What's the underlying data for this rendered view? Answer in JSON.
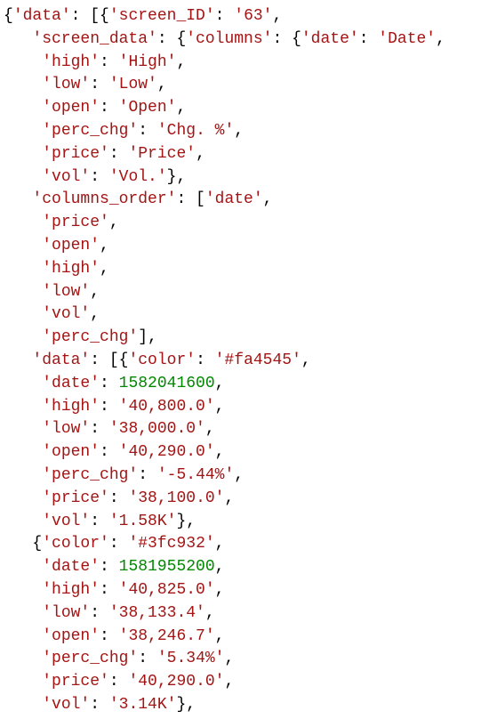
{
  "code_lines": [
    [
      [
        "punct",
        "{"
      ],
      [
        "key",
        "'data'"
      ],
      [
        "punct",
        ": [{"
      ],
      [
        "key",
        "'screen_ID'"
      ],
      [
        "punct",
        ": "
      ],
      [
        "str",
        "'63'"
      ],
      [
        "punct",
        ","
      ]
    ],
    [
      [
        "punct",
        "   "
      ],
      [
        "key",
        "'screen_data'"
      ],
      [
        "punct",
        ": {"
      ],
      [
        "key",
        "'columns'"
      ],
      [
        "punct",
        ": {"
      ],
      [
        "key",
        "'date'"
      ],
      [
        "punct",
        ": "
      ],
      [
        "str",
        "'Date'"
      ],
      [
        "punct",
        ","
      ]
    ],
    [
      [
        "punct",
        "    "
      ],
      [
        "key",
        "'high'"
      ],
      [
        "punct",
        ": "
      ],
      [
        "str",
        "'High'"
      ],
      [
        "punct",
        ","
      ]
    ],
    [
      [
        "punct",
        "    "
      ],
      [
        "key",
        "'low'"
      ],
      [
        "punct",
        ": "
      ],
      [
        "str",
        "'Low'"
      ],
      [
        "punct",
        ","
      ]
    ],
    [
      [
        "punct",
        "    "
      ],
      [
        "key",
        "'open'"
      ],
      [
        "punct",
        ": "
      ],
      [
        "str",
        "'Open'"
      ],
      [
        "punct",
        ","
      ]
    ],
    [
      [
        "punct",
        "    "
      ],
      [
        "key",
        "'perc_chg'"
      ],
      [
        "punct",
        ": "
      ],
      [
        "str",
        "'Chg. %'"
      ],
      [
        "punct",
        ","
      ]
    ],
    [
      [
        "punct",
        "    "
      ],
      [
        "key",
        "'price'"
      ],
      [
        "punct",
        ": "
      ],
      [
        "str",
        "'Price'"
      ],
      [
        "punct",
        ","
      ]
    ],
    [
      [
        "punct",
        "    "
      ],
      [
        "key",
        "'vol'"
      ],
      [
        "punct",
        ": "
      ],
      [
        "str",
        "'Vol.'"
      ],
      [
        "punct",
        "},"
      ]
    ],
    [
      [
        "punct",
        "   "
      ],
      [
        "key",
        "'columns_order'"
      ],
      [
        "punct",
        ": ["
      ],
      [
        "str",
        "'date'"
      ],
      [
        "punct",
        ","
      ]
    ],
    [
      [
        "punct",
        "    "
      ],
      [
        "str",
        "'price'"
      ],
      [
        "punct",
        ","
      ]
    ],
    [
      [
        "punct",
        "    "
      ],
      [
        "str",
        "'open'"
      ],
      [
        "punct",
        ","
      ]
    ],
    [
      [
        "punct",
        "    "
      ],
      [
        "str",
        "'high'"
      ],
      [
        "punct",
        ","
      ]
    ],
    [
      [
        "punct",
        "    "
      ],
      [
        "str",
        "'low'"
      ],
      [
        "punct",
        ","
      ]
    ],
    [
      [
        "punct",
        "    "
      ],
      [
        "str",
        "'vol'"
      ],
      [
        "punct",
        ","
      ]
    ],
    [
      [
        "punct",
        "    "
      ],
      [
        "str",
        "'perc_chg'"
      ],
      [
        "punct",
        "],"
      ]
    ],
    [
      [
        "punct",
        "   "
      ],
      [
        "key",
        "'data'"
      ],
      [
        "punct",
        ": [{"
      ],
      [
        "key",
        "'color'"
      ],
      [
        "punct",
        ": "
      ],
      [
        "str",
        "'#fa4545'"
      ],
      [
        "punct",
        ","
      ]
    ],
    [
      [
        "punct",
        "    "
      ],
      [
        "key",
        "'date'"
      ],
      [
        "punct",
        ": "
      ],
      [
        "num",
        "1582041600"
      ],
      [
        "punct",
        ","
      ]
    ],
    [
      [
        "punct",
        "    "
      ],
      [
        "key",
        "'high'"
      ],
      [
        "punct",
        ": "
      ],
      [
        "str",
        "'40,800.0'"
      ],
      [
        "punct",
        ","
      ]
    ],
    [
      [
        "punct",
        "    "
      ],
      [
        "key",
        "'low'"
      ],
      [
        "punct",
        ": "
      ],
      [
        "str",
        "'38,000.0'"
      ],
      [
        "punct",
        ","
      ]
    ],
    [
      [
        "punct",
        "    "
      ],
      [
        "key",
        "'open'"
      ],
      [
        "punct",
        ": "
      ],
      [
        "str",
        "'40,290.0'"
      ],
      [
        "punct",
        ","
      ]
    ],
    [
      [
        "punct",
        "    "
      ],
      [
        "key",
        "'perc_chg'"
      ],
      [
        "punct",
        ": "
      ],
      [
        "str",
        "'-5.44%'"
      ],
      [
        "punct",
        ","
      ]
    ],
    [
      [
        "punct",
        "    "
      ],
      [
        "key",
        "'price'"
      ],
      [
        "punct",
        ": "
      ],
      [
        "str",
        "'38,100.0'"
      ],
      [
        "punct",
        ","
      ]
    ],
    [
      [
        "punct",
        "    "
      ],
      [
        "key",
        "'vol'"
      ],
      [
        "punct",
        ": "
      ],
      [
        "str",
        "'1.58K'"
      ],
      [
        "punct",
        "},"
      ]
    ],
    [
      [
        "punct",
        "   {"
      ],
      [
        "key",
        "'color'"
      ],
      [
        "punct",
        ": "
      ],
      [
        "str",
        "'#3fc932'"
      ],
      [
        "punct",
        ","
      ]
    ],
    [
      [
        "punct",
        "    "
      ],
      [
        "key",
        "'date'"
      ],
      [
        "punct",
        ": "
      ],
      [
        "num",
        "1581955200"
      ],
      [
        "punct",
        ","
      ]
    ],
    [
      [
        "punct",
        "    "
      ],
      [
        "key",
        "'high'"
      ],
      [
        "punct",
        ": "
      ],
      [
        "str",
        "'40,825.0'"
      ],
      [
        "punct",
        ","
      ]
    ],
    [
      [
        "punct",
        "    "
      ],
      [
        "key",
        "'low'"
      ],
      [
        "punct",
        ": "
      ],
      [
        "str",
        "'38,133.4'"
      ],
      [
        "punct",
        ","
      ]
    ],
    [
      [
        "punct",
        "    "
      ],
      [
        "key",
        "'open'"
      ],
      [
        "punct",
        ": "
      ],
      [
        "str",
        "'38,246.7'"
      ],
      [
        "punct",
        ","
      ]
    ],
    [
      [
        "punct",
        "    "
      ],
      [
        "key",
        "'perc_chg'"
      ],
      [
        "punct",
        ": "
      ],
      [
        "str",
        "'5.34%'"
      ],
      [
        "punct",
        ","
      ]
    ],
    [
      [
        "punct",
        "    "
      ],
      [
        "key",
        "'price'"
      ],
      [
        "punct",
        ": "
      ],
      [
        "str",
        "'40,290.0'"
      ],
      [
        "punct",
        ","
      ]
    ],
    [
      [
        "punct",
        "    "
      ],
      [
        "key",
        "'vol'"
      ],
      [
        "punct",
        ": "
      ],
      [
        "str",
        "'3.14K'"
      ],
      [
        "punct",
        "},"
      ]
    ]
  ]
}
